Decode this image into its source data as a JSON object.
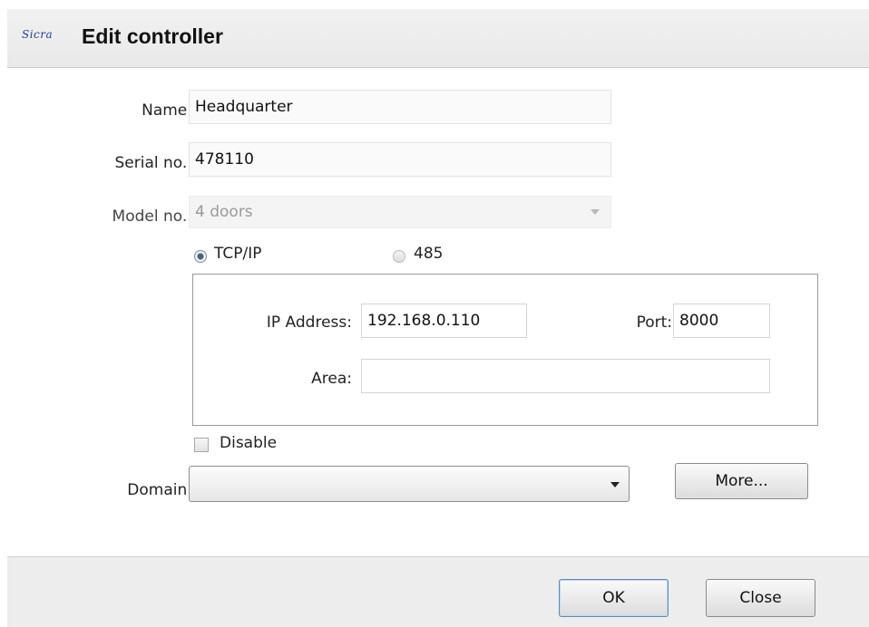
{
  "dialog": {
    "logo": "Sicra",
    "title": "Edit controller"
  },
  "form": {
    "name": {
      "label": "Name:",
      "value": "Headquarter"
    },
    "serial": {
      "label": "Serial no.:",
      "value": "478110"
    },
    "model": {
      "label": "Model no.:",
      "value": "4 doors",
      "disabled": true
    },
    "connection": {
      "options": [
        {
          "label": "TCP/IP",
          "selected": true
        },
        {
          "label": "485",
          "selected": false
        }
      ]
    },
    "ip": {
      "label": "IP Address:",
      "value": "192.168.0.110"
    },
    "port": {
      "label": "Port:",
      "value": "8000"
    },
    "area": {
      "label": "Area:",
      "value": ""
    },
    "disable": {
      "label": "Disable",
      "checked": false
    },
    "domain": {
      "label": "Domain:",
      "value": ""
    },
    "more_label": "More..."
  },
  "footer": {
    "ok_label": "OK",
    "close_label": "Close"
  },
  "colors": {
    "header_bg": "#ececec",
    "footer_bg": "#ededed",
    "default_button_border": "#5a8bbf",
    "logo": "#1f3f9c"
  },
  "icons": {
    "logo": "sicra-logo",
    "model_dropdown": "chevron-down-icon",
    "domain_dropdown": "chevron-down-icon"
  }
}
